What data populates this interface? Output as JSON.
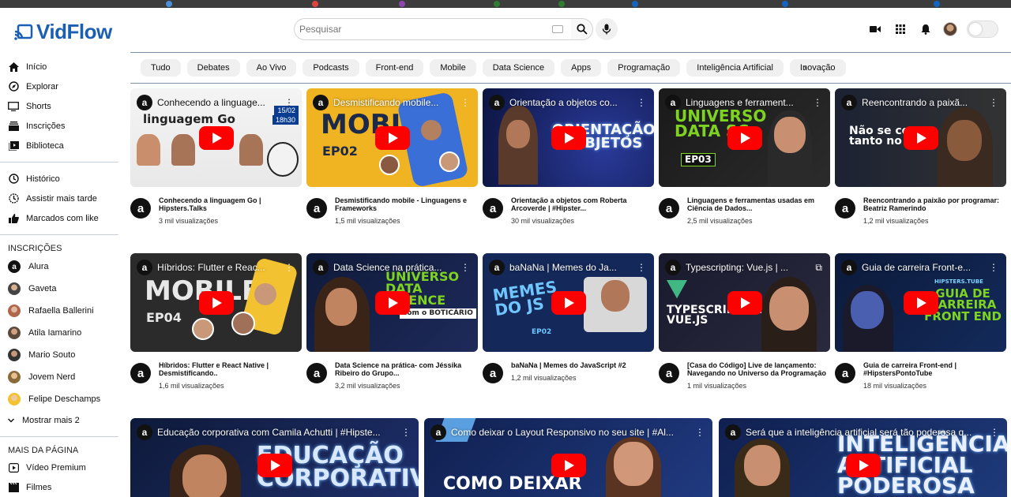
{
  "app": {
    "name": "VidFlow"
  },
  "search": {
    "placeholder": "Pesquisar"
  },
  "sidebar": {
    "main": [
      "Início",
      "Explorar",
      "Shorts",
      "Inscrições",
      "Biblioteca"
    ],
    "library": [
      "Histórico",
      "Assistir mais tarde",
      "Marcados com like"
    ],
    "subs_title": "INSCRIÇÕES",
    "subs": [
      "Alura",
      "Gaveta",
      "Rafaella Ballerini",
      "Atila Iamarino",
      "Mario Souto",
      "Jovem Nerd",
      "Felipe Deschamps"
    ],
    "show_more": "Mostrar mais 2",
    "more_title": "MAIS DA PÁGINA",
    "more": [
      "Vídeo Premium",
      "Filmes"
    ]
  },
  "chips": [
    "Tudo",
    "Debates",
    "Ao Vivo",
    "Podcasts",
    "Front-end",
    "Mobile",
    "Data Science",
    "Apps",
    "Programação",
    "Inteligência Artificial",
    "Inovação"
  ],
  "videos": [
    {
      "thumb_title": "Conhecendo a linguage...",
      "title": "Conhecendo a linguagem Go | Hipsters.Talks",
      "views": "3 mil visualizações",
      "thumb_text": "linguagem Go",
      "date": "15/02",
      "time": "18h30"
    },
    {
      "thumb_title": "Desmistificando mobile...",
      "title": "Desmistificando mobile - Linguagens e Frameworks",
      "views": "1,5 mil visualizações",
      "thumb_text": "MOBILE",
      "thumb_sub": "EP02"
    },
    {
      "thumb_title": "Orientação a objetos co...",
      "title": "Orientação a objetos com Roberta Arcoverde | #Hipster...",
      "views": "30 mil visualizações",
      "thumb_text": "ORIENTAÇÃO A OBJETOS"
    },
    {
      "thumb_title": "Linguagens e ferrament...",
      "title": "Linguagens e ferramentas usadas em Ciência de Dados...",
      "views": "2,5 mil visualizações",
      "thumb_text": "UNIVERSO DATA SC",
      "thumb_sub": "EP03"
    },
    {
      "thumb_title": "Reencontrando a paixã...",
      "title": "Reencontrando a paixão por programar: Beatriz Ramerindo",
      "views": "1,2 mil visualizações",
      "thumb_text": "Não se co tanto no i"
    },
    {
      "thumb_title": "Híbridos: Flutter e Reac...",
      "title": "Híbridos: Flutter e React Native | Desmistificando..",
      "views": "1,6 mil visualizações",
      "thumb_text": "MOBILE",
      "thumb_sub": "EP04"
    },
    {
      "thumb_title": "Data Science na prática...",
      "title": "Data Science na prática- com Jéssika Ribeiro do Grupo...",
      "views": "3,2 mil visualizações",
      "thumb_text": "UNIVERSO DATA SCIENCE",
      "thumb_sub": "com o BOTICÁRIO"
    },
    {
      "thumb_title": "baNaNa | Memes do Ja...",
      "title": "baNaNa | Memes do JavaScript #2",
      "views": "1,2 mil visualizações",
      "thumb_text": "MEMES DO JS",
      "thumb_sub": "EP02"
    },
    {
      "thumb_title": "Typescripting: Vue.js | ...",
      "title": "[Casa do Código] Live de lançamento: Navegando no Universo da Programação",
      "views": "1 mil visualizações",
      "thumb_text": "TYPESCRIPTING: VUE.JS"
    },
    {
      "thumb_title": "Guia de carreira Front-e...",
      "title": "Guia de carreira Front-end | #HipstersPontoTube",
      "views": "18 mil visualizações",
      "thumb_text": "GUIA DE CARREIRA FRONT END",
      "thumb_sub": "HIPSTERS.TUBE"
    },
    {
      "thumb_title": "Educação corporativa com Camila Achutti | #Hipste...",
      "thumb_text": "EDUCAÇÃO CORPORATIVA"
    },
    {
      "thumb_title": "Como deixar o Layout Responsivo no seu site | #Al...",
      "thumb_text": "COMO DEIXAR"
    },
    {
      "thumb_title": "Será que a inteligência artificial será tão poderosa q...",
      "thumb_text": "INTELIGÊNCIA ARTIFICIAL PODEROSA"
    }
  ],
  "colors": {
    "brand": "#1a5fb4",
    "play": "#ff0000",
    "chip": "#f0f0f0"
  }
}
